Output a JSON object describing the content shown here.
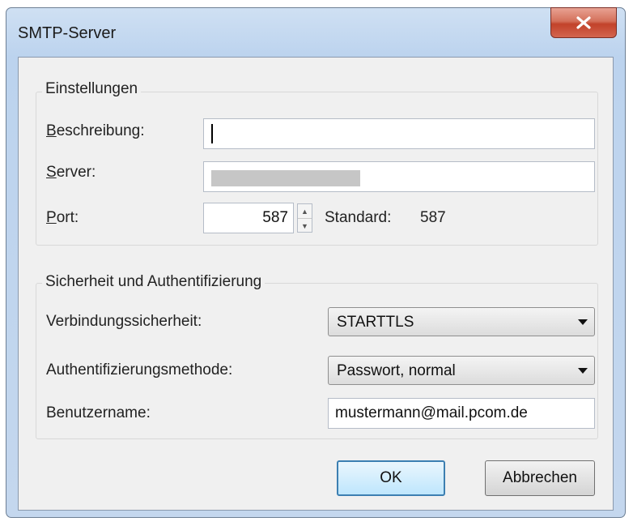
{
  "window": {
    "title": "SMTP-Server"
  },
  "settings": {
    "group_label": "Einstellungen",
    "description_label": "Beschreibung:",
    "description_value": "",
    "server_label": "Server:",
    "port_label": "Port:",
    "port_value": "587",
    "standard_label": "Standard:",
    "standard_value": "587"
  },
  "security": {
    "group_label": "Sicherheit und Authentifizierung",
    "connection_label": "Verbindungssicherheit:",
    "connection_value": "STARTTLS",
    "auth_label": "Authentifizierungsmethode:",
    "auth_value": "Passwort, normal",
    "username_label": "Benutzername:",
    "username_value": "mustermann@mail.pcom.de"
  },
  "buttons": {
    "ok": "OK",
    "cancel": "Abbrechen"
  },
  "icons": {
    "close": "close-icon",
    "spin_up": "arrow-up-icon",
    "spin_down": "arrow-down-icon",
    "dropdown": "chevron-down-icon"
  }
}
